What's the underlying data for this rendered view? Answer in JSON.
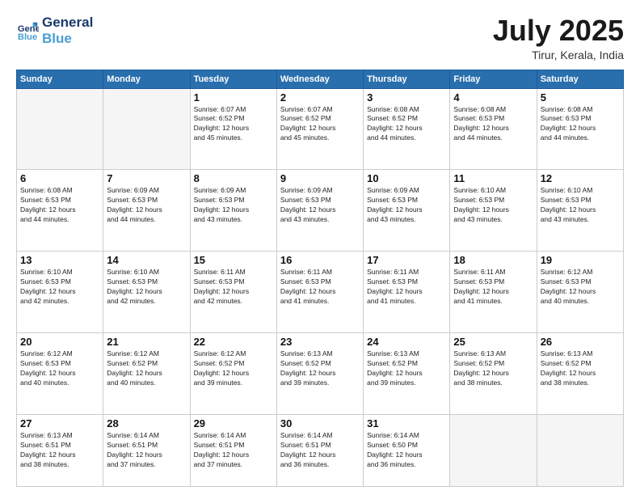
{
  "logo": {
    "line1": "General",
    "line2": "Blue"
  },
  "header": {
    "month_year": "July 2025",
    "location": "Tirur, Kerala, India"
  },
  "weekdays": [
    "Sunday",
    "Monday",
    "Tuesday",
    "Wednesday",
    "Thursday",
    "Friday",
    "Saturday"
  ],
  "weeks": [
    [
      {
        "day": "",
        "info": ""
      },
      {
        "day": "",
        "info": ""
      },
      {
        "day": "1",
        "info": "Sunrise: 6:07 AM\nSunset: 6:52 PM\nDaylight: 12 hours\nand 45 minutes."
      },
      {
        "day": "2",
        "info": "Sunrise: 6:07 AM\nSunset: 6:52 PM\nDaylight: 12 hours\nand 45 minutes."
      },
      {
        "day": "3",
        "info": "Sunrise: 6:08 AM\nSunset: 6:52 PM\nDaylight: 12 hours\nand 44 minutes."
      },
      {
        "day": "4",
        "info": "Sunrise: 6:08 AM\nSunset: 6:53 PM\nDaylight: 12 hours\nand 44 minutes."
      },
      {
        "day": "5",
        "info": "Sunrise: 6:08 AM\nSunset: 6:53 PM\nDaylight: 12 hours\nand 44 minutes."
      }
    ],
    [
      {
        "day": "6",
        "info": "Sunrise: 6:08 AM\nSunset: 6:53 PM\nDaylight: 12 hours\nand 44 minutes."
      },
      {
        "day": "7",
        "info": "Sunrise: 6:09 AM\nSunset: 6:53 PM\nDaylight: 12 hours\nand 44 minutes."
      },
      {
        "day": "8",
        "info": "Sunrise: 6:09 AM\nSunset: 6:53 PM\nDaylight: 12 hours\nand 43 minutes."
      },
      {
        "day": "9",
        "info": "Sunrise: 6:09 AM\nSunset: 6:53 PM\nDaylight: 12 hours\nand 43 minutes."
      },
      {
        "day": "10",
        "info": "Sunrise: 6:09 AM\nSunset: 6:53 PM\nDaylight: 12 hours\nand 43 minutes."
      },
      {
        "day": "11",
        "info": "Sunrise: 6:10 AM\nSunset: 6:53 PM\nDaylight: 12 hours\nand 43 minutes."
      },
      {
        "day": "12",
        "info": "Sunrise: 6:10 AM\nSunset: 6:53 PM\nDaylight: 12 hours\nand 43 minutes."
      }
    ],
    [
      {
        "day": "13",
        "info": "Sunrise: 6:10 AM\nSunset: 6:53 PM\nDaylight: 12 hours\nand 42 minutes."
      },
      {
        "day": "14",
        "info": "Sunrise: 6:10 AM\nSunset: 6:53 PM\nDaylight: 12 hours\nand 42 minutes."
      },
      {
        "day": "15",
        "info": "Sunrise: 6:11 AM\nSunset: 6:53 PM\nDaylight: 12 hours\nand 42 minutes."
      },
      {
        "day": "16",
        "info": "Sunrise: 6:11 AM\nSunset: 6:53 PM\nDaylight: 12 hours\nand 41 minutes."
      },
      {
        "day": "17",
        "info": "Sunrise: 6:11 AM\nSunset: 6:53 PM\nDaylight: 12 hours\nand 41 minutes."
      },
      {
        "day": "18",
        "info": "Sunrise: 6:11 AM\nSunset: 6:53 PM\nDaylight: 12 hours\nand 41 minutes."
      },
      {
        "day": "19",
        "info": "Sunrise: 6:12 AM\nSunset: 6:53 PM\nDaylight: 12 hours\nand 40 minutes."
      }
    ],
    [
      {
        "day": "20",
        "info": "Sunrise: 6:12 AM\nSunset: 6:53 PM\nDaylight: 12 hours\nand 40 minutes."
      },
      {
        "day": "21",
        "info": "Sunrise: 6:12 AM\nSunset: 6:52 PM\nDaylight: 12 hours\nand 40 minutes."
      },
      {
        "day": "22",
        "info": "Sunrise: 6:12 AM\nSunset: 6:52 PM\nDaylight: 12 hours\nand 39 minutes."
      },
      {
        "day": "23",
        "info": "Sunrise: 6:13 AM\nSunset: 6:52 PM\nDaylight: 12 hours\nand 39 minutes."
      },
      {
        "day": "24",
        "info": "Sunrise: 6:13 AM\nSunset: 6:52 PM\nDaylight: 12 hours\nand 39 minutes."
      },
      {
        "day": "25",
        "info": "Sunrise: 6:13 AM\nSunset: 6:52 PM\nDaylight: 12 hours\nand 38 minutes."
      },
      {
        "day": "26",
        "info": "Sunrise: 6:13 AM\nSunset: 6:52 PM\nDaylight: 12 hours\nand 38 minutes."
      }
    ],
    [
      {
        "day": "27",
        "info": "Sunrise: 6:13 AM\nSunset: 6:51 PM\nDaylight: 12 hours\nand 38 minutes."
      },
      {
        "day": "28",
        "info": "Sunrise: 6:14 AM\nSunset: 6:51 PM\nDaylight: 12 hours\nand 37 minutes."
      },
      {
        "day": "29",
        "info": "Sunrise: 6:14 AM\nSunset: 6:51 PM\nDaylight: 12 hours\nand 37 minutes."
      },
      {
        "day": "30",
        "info": "Sunrise: 6:14 AM\nSunset: 6:51 PM\nDaylight: 12 hours\nand 36 minutes."
      },
      {
        "day": "31",
        "info": "Sunrise: 6:14 AM\nSunset: 6:50 PM\nDaylight: 12 hours\nand 36 minutes."
      },
      {
        "day": "",
        "info": ""
      },
      {
        "day": "",
        "info": ""
      }
    ]
  ]
}
